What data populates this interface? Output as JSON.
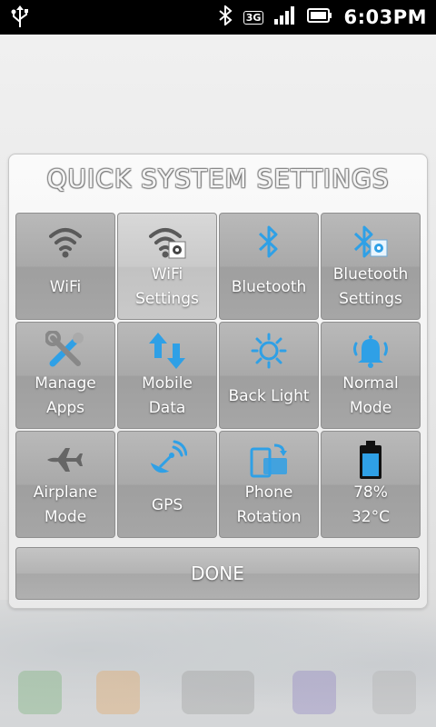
{
  "status_bar": {
    "time": "6:03PM",
    "network": "3G"
  },
  "dialog": {
    "title": "QUICK SYSTEM SETTINGS",
    "done_label": "DONE",
    "tiles": [
      {
        "id": "wifi",
        "lines": [
          "WiFi"
        ],
        "icon": "wifi-icon"
      },
      {
        "id": "wifi-settings",
        "lines": [
          "WiFi",
          "Settings"
        ],
        "icon": "wifi-settings-icon"
      },
      {
        "id": "bluetooth",
        "lines": [
          "Bluetooth"
        ],
        "icon": "bluetooth-icon"
      },
      {
        "id": "bluetooth-settings",
        "lines": [
          "Bluetooth",
          "Settings"
        ],
        "icon": "bluetooth-settings-icon"
      },
      {
        "id": "manage-apps",
        "lines": [
          "Manage",
          "Apps"
        ],
        "icon": "tools-icon"
      },
      {
        "id": "mobile-data",
        "lines": [
          "Mobile",
          "Data"
        ],
        "icon": "data-arrows-icon"
      },
      {
        "id": "back-light",
        "lines": [
          "Back Light"
        ],
        "icon": "sun-icon"
      },
      {
        "id": "normal-mode",
        "lines": [
          "Normal",
          "Mode"
        ],
        "icon": "bell-icon"
      },
      {
        "id": "airplane-mode",
        "lines": [
          "Airplane",
          "Mode"
        ],
        "icon": "airplane-icon"
      },
      {
        "id": "gps",
        "lines": [
          "GPS"
        ],
        "icon": "satellite-icon"
      },
      {
        "id": "phone-rotation",
        "lines": [
          "Phone",
          "Rotation"
        ],
        "icon": "rotation-icon"
      },
      {
        "id": "battery",
        "lines": [
          "78%",
          "32°C"
        ],
        "icon": "battery-icon"
      }
    ]
  },
  "colors": {
    "accent": "#2fa0e6",
    "tile_text": "#ffffff",
    "status_bar": "#000000"
  }
}
